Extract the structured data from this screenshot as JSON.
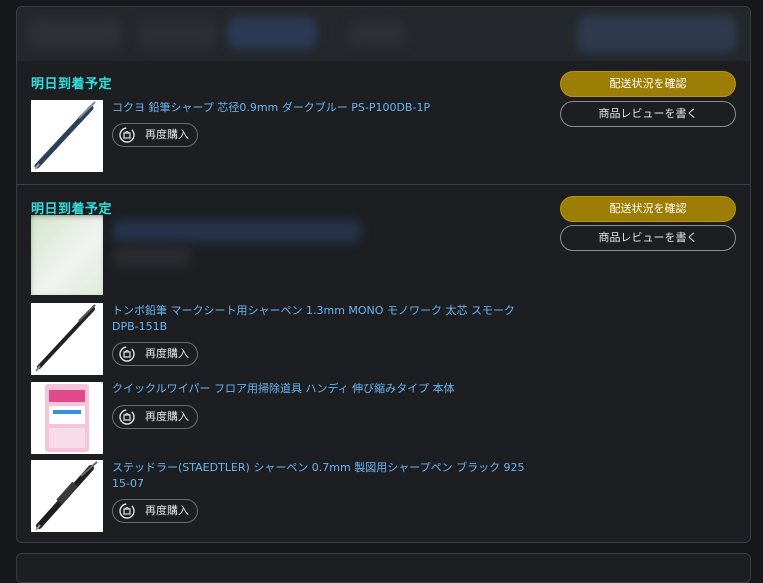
{
  "orders": [
    {
      "status": "明日到着予定",
      "buttons": {
        "track": "配送状況を確認",
        "review": "商品レビューを書く"
      },
      "items": [
        {
          "title": "コクヨ 鉛筆シャープ 芯径0.9mm ダークブルー PS-P100DB-1P",
          "rebuy": "再度購入",
          "image": "dark-blue-mechanical-pencil"
        }
      ]
    },
    {
      "status": "明日到着予定",
      "buttons": {
        "track": "配送状況を確認",
        "review": "商品レビューを書く"
      },
      "items": [
        {
          "title": "",
          "rebuy": "",
          "image": "blurred-product"
        },
        {
          "title": "トンボ鉛筆 マークシート用シャーペン 1.3mm MONO モノワーク 太芯 スモーク DPB-151B",
          "rebuy": "再度購入",
          "image": "black-mechanical-pencil"
        },
        {
          "title": "クイックルワイパー フロア用掃除道具 ハンディ 伸び縮みタイプ 本体",
          "rebuy": "再度購入",
          "image": "quickle-wiper-package"
        },
        {
          "title": "ステッドラー(STAEDTLER) シャーペン 0.7mm 製図用シャープペン ブラック 925 15-07",
          "rebuy": "再度購入",
          "image": "staedtler-mechanical-pencil"
        }
      ]
    }
  ],
  "icons": {
    "rebuy": "rebuy-refresh-cart-icon"
  },
  "colors": {
    "status": "#33e0df",
    "link": "#6ab4f0",
    "primary_button": "#9c7d06"
  }
}
